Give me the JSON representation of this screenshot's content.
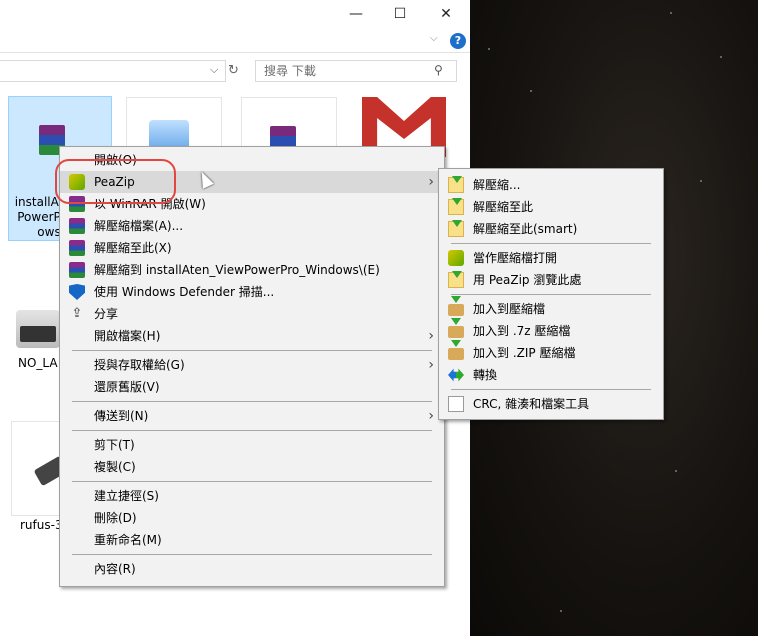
{
  "window": {
    "minimize": "—",
    "maximize": "☐",
    "close": "✕",
    "help": "?",
    "ribbon_chevron": "⌵"
  },
  "address": {
    "chevron": "⌵",
    "refresh": "↻"
  },
  "search": {
    "placeholder": "搜尋 下載",
    "icon": "⚲"
  },
  "files": [
    {
      "label_lines": [
        "installAt",
        "PowerP",
        "ows"
      ],
      "selected": true
    },
    {
      "label": "NO_LA"
    },
    {
      "label": "rufus-3"
    }
  ],
  "context_menu": {
    "items": [
      {
        "label": "開啟(O)",
        "icon": ""
      },
      {
        "label": "PeaZip",
        "icon": "pea",
        "submenu": true,
        "highlighted": true
      },
      {
        "label": "以 WinRAR 開啟(W)",
        "icon": "rar"
      },
      {
        "label": "解壓縮檔案(A)...",
        "icon": "rar"
      },
      {
        "label": "解壓縮至此(X)",
        "icon": "rar"
      },
      {
        "label": "解壓縮到 installAten_ViewPowerPro_Windows\\(E)",
        "icon": "rar"
      },
      {
        "label": "使用 Windows Defender 掃描...",
        "icon": "shield"
      },
      {
        "label": "分享",
        "icon": "share"
      },
      {
        "label": "開啟檔案(H)",
        "icon": "",
        "submenu": true
      },
      {
        "sep": true
      },
      {
        "label": "授與存取權給(G)",
        "icon": "",
        "submenu": true
      },
      {
        "label": "還原舊版(V)",
        "icon": ""
      },
      {
        "sep": true
      },
      {
        "label": "傳送到(N)",
        "icon": "",
        "submenu": true
      },
      {
        "sep": true
      },
      {
        "label": "剪下(T)",
        "icon": ""
      },
      {
        "label": "複製(C)",
        "icon": ""
      },
      {
        "sep": true
      },
      {
        "label": "建立捷徑(S)",
        "icon": ""
      },
      {
        "label": "刪除(D)",
        "icon": ""
      },
      {
        "label": "重新命名(M)",
        "icon": ""
      },
      {
        "sep": true
      },
      {
        "label": "內容(R)",
        "icon": ""
      }
    ]
  },
  "peazip_submenu": {
    "items": [
      {
        "label": "解壓縮...",
        "icon": "ext"
      },
      {
        "label": "解壓縮至此",
        "icon": "ext"
      },
      {
        "label": "解壓縮至此(smart)",
        "icon": "ext"
      },
      {
        "sep": true
      },
      {
        "label": "當作壓縮檔打開",
        "icon": "pea"
      },
      {
        "label": "用 PeaZip 瀏覽此處",
        "icon": "ext"
      },
      {
        "sep": true
      },
      {
        "label": "加入到壓縮檔",
        "icon": "add"
      },
      {
        "label": "加入到 .7z 壓縮檔",
        "icon": "add"
      },
      {
        "label": "加入到 .ZIP 壓縮檔",
        "icon": "add"
      },
      {
        "label": "轉換",
        "icon": "conv"
      },
      {
        "sep": true
      },
      {
        "label": "CRC, 雜湊和檔案工具",
        "icon": "tool"
      }
    ]
  },
  "submenu_arrow": "›",
  "colors": {
    "highlight_ring": "#e2473f",
    "menu_bg": "#f2f2f2",
    "selection": "#cce8ff"
  }
}
